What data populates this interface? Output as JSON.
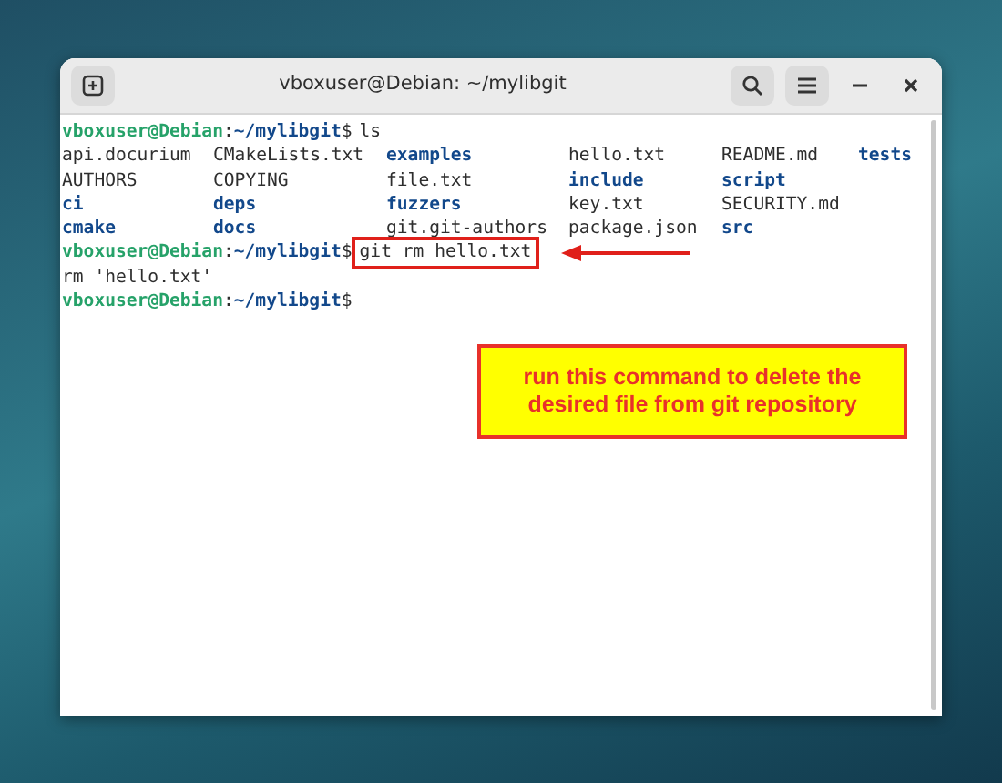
{
  "window": {
    "title": "vboxuser@Debian: ~/mylibgit"
  },
  "terminal": {
    "lines": [
      {
        "kind": "prompt",
        "user_host": "vboxuser@Debian",
        "separator": ":",
        "path": "~/mylibgit",
        "sign": "$",
        "command": "ls",
        "highlighted": false
      },
      {
        "kind": "listing",
        "rows": [
          [
            {
              "name": "api.docurium",
              "is_dir": false
            },
            {
              "name": "CMakeLists.txt",
              "is_dir": false
            },
            {
              "name": "examples",
              "is_dir": true
            },
            {
              "name": "hello.txt",
              "is_dir": false
            },
            {
              "name": "README.md",
              "is_dir": false
            },
            {
              "name": "tests",
              "is_dir": true
            }
          ],
          [
            {
              "name": "AUTHORS",
              "is_dir": false
            },
            {
              "name": "COPYING",
              "is_dir": false
            },
            {
              "name": "file.txt",
              "is_dir": false
            },
            {
              "name": "include",
              "is_dir": true
            },
            {
              "name": "script",
              "is_dir": true
            }
          ],
          [
            {
              "name": "ci",
              "is_dir": true
            },
            {
              "name": "deps",
              "is_dir": true
            },
            {
              "name": "fuzzers",
              "is_dir": true
            },
            {
              "name": "key.txt",
              "is_dir": false
            },
            {
              "name": "SECURITY.md",
              "is_dir": false
            }
          ],
          [
            {
              "name": "cmake",
              "is_dir": true
            },
            {
              "name": "docs",
              "is_dir": true
            },
            {
              "name": "git.git-authors",
              "is_dir": false
            },
            {
              "name": "package.json",
              "is_dir": false
            },
            {
              "name": "src",
              "is_dir": true
            }
          ]
        ]
      },
      {
        "kind": "prompt",
        "user_host": "vboxuser@Debian",
        "separator": ":",
        "path": "~/mylibgit",
        "sign": "$",
        "command": "git rm hello.txt",
        "highlighted": true
      },
      {
        "kind": "output",
        "text": "rm 'hello.txt'"
      },
      {
        "kind": "prompt",
        "user_host": "vboxuser@Debian",
        "separator": ":",
        "path": "~/mylibgit",
        "sign": "$",
        "highlighted": false
      }
    ]
  },
  "callout": {
    "text": "run this command to delete the desired file from git repository"
  }
}
